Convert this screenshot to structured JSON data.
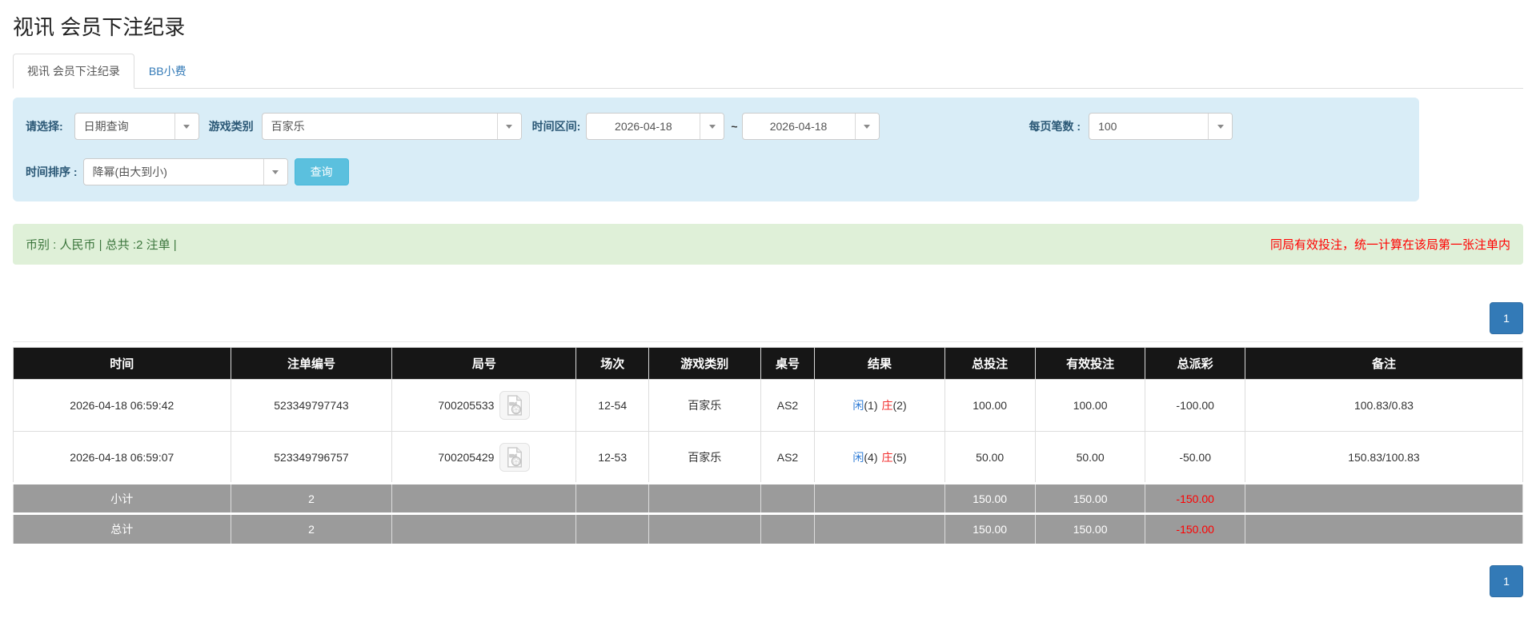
{
  "page": {
    "title": "视讯 会员下注纪录"
  },
  "tabs": [
    {
      "label": "视讯 会员下注纪录",
      "active": true
    },
    {
      "label": "BB小费",
      "active": false
    }
  ],
  "filters": {
    "select_type": {
      "label": "请选择:",
      "value": "日期查询"
    },
    "game_category": {
      "label": "游戏类别",
      "value": "百家乐"
    },
    "time_range": {
      "label": "时间区间:",
      "from": "2026-04-18",
      "separator": "~",
      "to": "2026-04-18"
    },
    "page_size": {
      "label": "每页笔数 :",
      "value": "100"
    },
    "time_sort": {
      "label": "时间排序 :",
      "value": "降幂(由大到小)"
    },
    "query_button": "查询"
  },
  "summary_bar": {
    "left_text": "币别 : 人民币 | 总共 :2 注单 |",
    "right_notice": "同局有效投注，统一计算在该局第一张注单内"
  },
  "pagination": {
    "page": "1"
  },
  "table": {
    "headers": [
      "时间",
      "注单编号",
      "局号",
      "场次",
      "游戏类别",
      "桌号",
      "结果",
      "总投注",
      "有效投注",
      "总派彩",
      "备注"
    ],
    "rows": [
      {
        "time": "2026-04-18 06:59:42",
        "bet_id": "523349797743",
        "round_id": "700205533",
        "session": "12-54",
        "game": "百家乐",
        "table_no": "AS2",
        "result": {
          "player_label": "闲",
          "player_value": "(1)",
          "banker_label": "庄",
          "banker_value": "(2)"
        },
        "total_bet": "100.00",
        "valid_bet": "100.00",
        "payout": "-100.00",
        "remark": "100.83/0.83"
      },
      {
        "time": "2026-04-18 06:59:07",
        "bet_id": "523349796757",
        "round_id": "700205429",
        "session": "12-53",
        "game": "百家乐",
        "table_no": "AS2",
        "result": {
          "player_label": "闲",
          "player_value": "(4)",
          "banker_label": "庄",
          "banker_value": "(5)"
        },
        "total_bet": "50.00",
        "valid_bet": "50.00",
        "payout": "-50.00",
        "remark": "150.83/100.83"
      }
    ],
    "subtotal": {
      "label": "小计",
      "count": "2",
      "total_bet": "150.00",
      "valid_bet": "150.00",
      "payout": "-150.00"
    },
    "grand_total": {
      "label": "总计",
      "count": "2",
      "total_bet": "150.00",
      "valid_bet": "150.00",
      "payout": "-150.00"
    }
  },
  "colors": {
    "filter_panel_bg": "#d9edf7",
    "filter_label": "#2b5876",
    "query_button_bg": "#5bc0de",
    "notice_bar_bg": "#dff0d8",
    "notice_left_text": "#3c763d",
    "notice_right_text": "#ff0000",
    "pager_button_bg": "#337ab7",
    "table_header_bg": "#161616",
    "summary_row_bg": "#9b9b9b",
    "amount_link_blue": "#2f7cd6",
    "negative_red": "#ff0000",
    "player_blue": "#2f7cd6",
    "banker_red": "#f23030"
  },
  "icons": {
    "caret_down": "▾",
    "video_record": "video-file"
  }
}
